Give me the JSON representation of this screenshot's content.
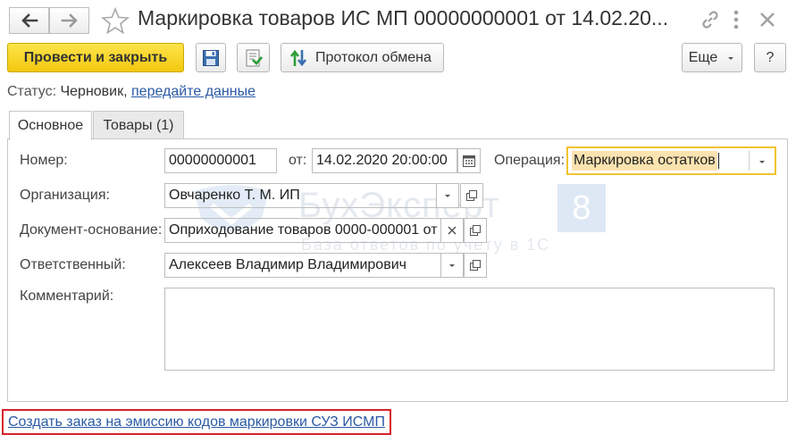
{
  "window": {
    "title": "Маркировка товаров ИС МП 00000000001 от 14.02.20..."
  },
  "toolbar": {
    "post_close_label": "Провести и закрыть",
    "exchange_log_label": "Протокол обмена",
    "more_label": "Еще",
    "help_label": "?"
  },
  "status": {
    "label": "Статус:",
    "value": "Черновик,",
    "link": "передайте данные"
  },
  "tabs": [
    {
      "label": "Основное",
      "active": true
    },
    {
      "label": "Товары (1)",
      "active": false
    }
  ],
  "form": {
    "number_label": "Номер:",
    "number_value": "00000000001",
    "date_label": "от:",
    "date_value": "14.02.2020 20:00:00",
    "operation_label": "Операция:",
    "operation_value": "Маркировка остатков",
    "organization_label": "Организация:",
    "organization_value": "Овчаренко Т. М. ИП",
    "base_document_label": "Документ-основание:",
    "base_document_value": "Оприходование товаров 0000-000001 от",
    "responsible_label": "Ответственный:",
    "responsible_value": "Алексеев Владимир Владимирович",
    "comment_label": "Комментарий:",
    "comment_value": ""
  },
  "watermark": {
    "brand": "БухЭксперт",
    "badge": "8",
    "tagline": "База ответов по учёту в 1С"
  },
  "footer": {
    "create_order_link": "Создать заказ на эмиссию кодов маркировки СУЗ ИСМП"
  },
  "colors": {
    "primary_button": "#f5cf1c",
    "link": "#2a5aa4",
    "highlight_border": "#f0c42e",
    "annotation_frame": "#d8232a"
  }
}
